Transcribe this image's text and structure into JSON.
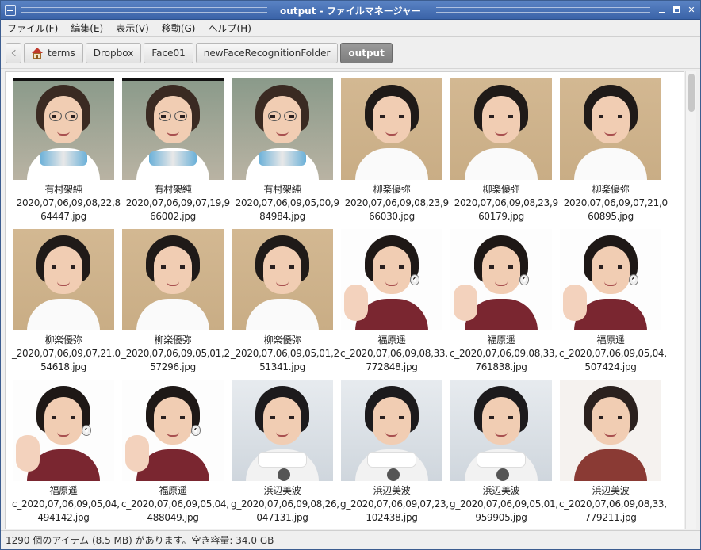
{
  "window": {
    "title": "output - ファイルマネージャー",
    "controls": {
      "minimize": "minimize-button",
      "maximize": "maximize-button",
      "close": "close-button"
    }
  },
  "menu": [
    "ファイル(F)",
    "編集(E)",
    "表示(V)",
    "移動(G)",
    "ヘルプ(H)"
  ],
  "path": {
    "crumbs": [
      "terms",
      "Dropbox",
      "Face01",
      "newFaceRecognitionFolder",
      "output"
    ],
    "home_icon": "home-icon"
  },
  "files": [
    {
      "line1": "有村架純",
      "line2": "_2020,07,06,09,08,22,8",
      "line3": "64447.jpg"
    },
    {
      "line1": "有村架純",
      "line2": "_2020,07,06,09,07,19,9",
      "line3": "66002.jpg"
    },
    {
      "line1": "有村架純",
      "line2": "_2020,07,06,09,05,00,9",
      "line3": "84984.jpg"
    },
    {
      "line1": "柳楽優弥",
      "line2": "_2020,07,06,09,08,23,9",
      "line3": "66030.jpg"
    },
    {
      "line1": "柳楽優弥",
      "line2": "_2020,07,06,09,08,23,9",
      "line3": "60179.jpg"
    },
    {
      "line1": "柳楽優弥",
      "line2": "_2020,07,06,09,07,21,0",
      "line3": "60895.jpg"
    },
    {
      "line1": "柳楽優弥",
      "line2": "_2020,07,06,09,07,21,0",
      "line3": "54618.jpg"
    },
    {
      "line1": "柳楽優弥",
      "line2": "_2020,07,06,09,05,01,2",
      "line3": "57296.jpg"
    },
    {
      "line1": "柳楽優弥",
      "line2": "_2020,07,06,09,05,01,2",
      "line3": "51341.jpg"
    },
    {
      "line1": "福原遥",
      "line2": "c_2020,07,06,09,08,33,",
      "line3": "772848.jpg"
    },
    {
      "line1": "福原遥",
      "line2": "c_2020,07,06,09,08,33,",
      "line3": "761838.jpg"
    },
    {
      "line1": "福原遥",
      "line2": "c_2020,07,06,09,05,04,",
      "line3": "507424.jpg"
    },
    {
      "line1": "福原遥",
      "line2": "c_2020,07,06,09,05,04,",
      "line3": "494142.jpg"
    },
    {
      "line1": "福原遥",
      "line2": "c_2020,07,06,09,05,04,",
      "line3": "488049.jpg"
    },
    {
      "line1": "浜辺美波",
      "line2": "g_2020,07,06,09,08,26,",
      "line3": "047131.jpg"
    },
    {
      "line1": "浜辺美波",
      "line2": "g_2020,07,06,09,07,23,",
      "line3": "102438.jpg"
    },
    {
      "line1": "浜辺美波",
      "line2": "g_2020,07,06,09,05,01,",
      "line3": "959905.jpg"
    },
    {
      "line1": "浜辺美波",
      "line2": "c_2020,07,06,09,08,33,",
      "line3": "779211.jpg"
    }
  ],
  "status": "1290 個のアイテム (8.5 MB) があります。空き容量: 34.0 GB",
  "colors": {
    "titlebar": "#4a73b6",
    "current_crumb": "#8a8a8a"
  }
}
